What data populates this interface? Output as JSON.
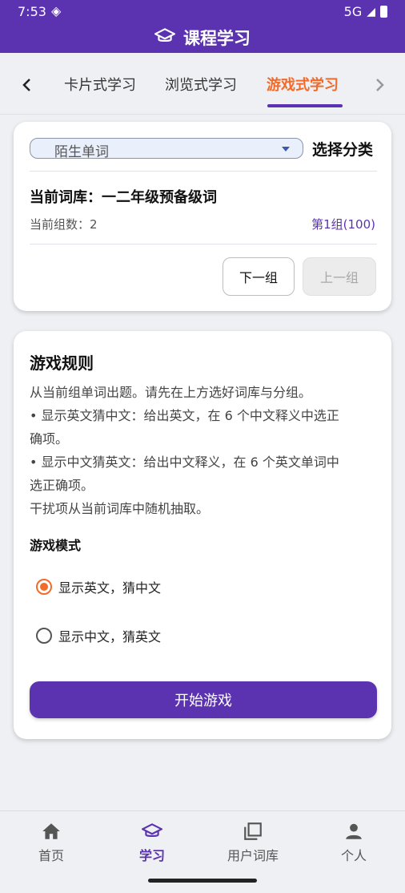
{
  "status_bar": {
    "time": "7:53",
    "network": "5G"
  },
  "app_bar": {
    "title": "课程学习",
    "icon": "graduation-cap-icon"
  },
  "tabs": {
    "items": [
      {
        "label": "卡片式学习"
      },
      {
        "label": "浏览式学习"
      },
      {
        "label": "游戏式学习",
        "active": true
      }
    ],
    "prev_icon": "chevron-left-icon",
    "next_icon": "chevron-right-icon"
  },
  "library_card": {
    "category_select": {
      "value": "陌生单词"
    },
    "select_label": "选择分类",
    "current_library": "当前词库：一二年级预备级词",
    "group_count": "当前组数：2",
    "group_range": "第1组(100)",
    "next_button": "下一组",
    "prev_button": "上一组"
  },
  "rules_card": {
    "title": "游戏规则",
    "lines": [
      "从当前组单词出题。请先在上方选好词库与分组。",
      "• 显示英文猜中文：给出英文，在 6 个中文释义中选正",
      "确项。",
      "• 显示中文猜英文：给出中文释义，在 6 个英文单词中",
      "选正确项。",
      "干扰项从当前词库中随机抽取。"
    ],
    "mode_title": "游戏模式",
    "modes": [
      {
        "label": "显示英文，猜中文",
        "selected": true
      },
      {
        "label": "显示中文，猜英文",
        "selected": false
      }
    ],
    "start_button": "开始游戏"
  },
  "bottom_nav": {
    "items": [
      {
        "label": "首页",
        "icon": "home-icon"
      },
      {
        "label": "学习",
        "icon": "graduation-cap-icon",
        "active": true
      },
      {
        "label": "用户词库",
        "icon": "library-icon"
      },
      {
        "label": "个人",
        "icon": "person-icon"
      }
    ]
  },
  "colors": {
    "primary": "#5b33b0",
    "accent": "#f26b2a",
    "background": "#eef0f4"
  }
}
